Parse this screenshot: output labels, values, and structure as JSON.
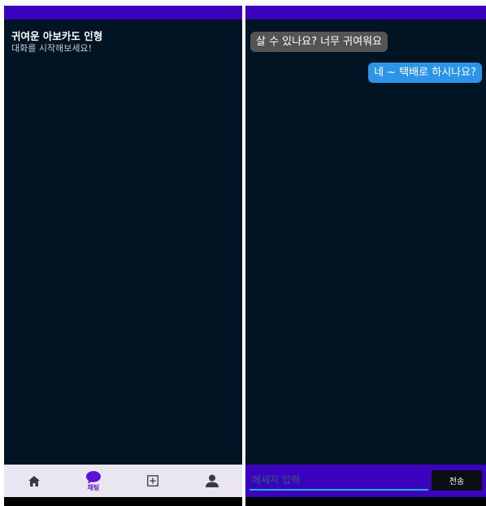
{
  "chat_list": {
    "items": [
      {
        "title": "귀여운 아보카도 인형",
        "preview": "대화를 시작해보세요!"
      }
    ]
  },
  "bottom_nav": {
    "active": "chat",
    "items": [
      {
        "id": "home",
        "icon": "home-icon",
        "label": ""
      },
      {
        "id": "chat",
        "icon": "chat-bubble-icon",
        "label": "채팅"
      },
      {
        "id": "add",
        "icon": "add-box-icon",
        "label": ""
      },
      {
        "id": "profile",
        "icon": "person-icon",
        "label": ""
      }
    ]
  },
  "conversation": {
    "messages": [
      {
        "direction": "incoming",
        "text": "살 수 있나요? 너무 귀여워요"
      },
      {
        "direction": "outgoing",
        "text": "네 ~ 택배로 하시나요?"
      }
    ]
  },
  "composer": {
    "placeholder": "메세지 입력",
    "value": "",
    "send_label": "전송"
  },
  "colors": {
    "status_bar": "#3b03bd",
    "background": "#011423",
    "nav_background": "#e9e6f2",
    "accent": "#5a11d8",
    "incoming_bubble": "#545455",
    "outgoing_bubble": "#2d95e8",
    "input_underline": "#20b2d8"
  }
}
